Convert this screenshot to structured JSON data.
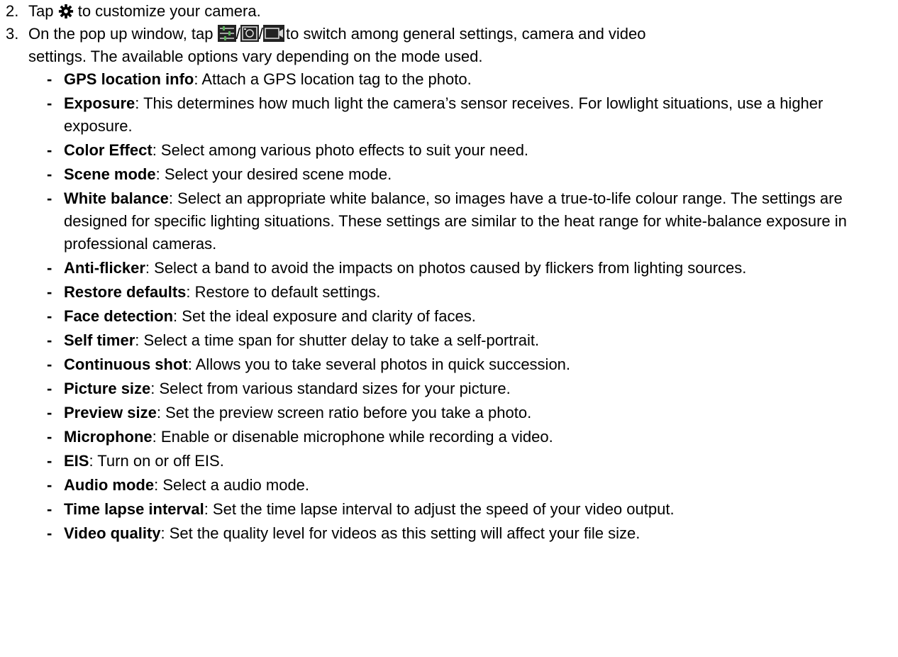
{
  "steps": {
    "step2": {
      "number": "2.",
      "text_before": "Tap ",
      "text_after": " to customize your camera.",
      "icon": "gear-icon"
    },
    "step3": {
      "number": "3.",
      "text_before": "On the pop up window, tap ",
      "separator": "/",
      "text_after": " to switch among general settings, camera and video",
      "continuation": "settings. The available options vary depending on the mode used.",
      "icons": [
        "sliders-icon",
        "camera-icon",
        "video-icon"
      ]
    }
  },
  "bullets": [
    {
      "term": "GPS location info",
      "desc": ": Attach a GPS location tag to the photo."
    },
    {
      "term": "Exposure",
      "desc": ": This determines how much light the camera’s sensor receives. For lowlight situations, use a higher exposure."
    },
    {
      "term": "Color Effect",
      "desc": ": Select among various photo effects to suit your need."
    },
    {
      "term": "Scene mode",
      "desc": ": Select your desired scene mode."
    },
    {
      "term": "White balance",
      "desc": ": Select an appropriate white balance, so images have a true-to-life colour range. The settings are designed for specific lighting situations. These settings are similar to the heat range for white-balance exposure in professional cameras."
    },
    {
      "term": "Anti-flicker",
      "desc": ": Select a band to avoid the impacts on photos caused by flickers from lighting sources."
    },
    {
      "term": "Restore defaults",
      "desc": ": Restore to default settings."
    },
    {
      "term": "Face detection",
      "desc": ":  Set the ideal exposure and clarity of faces."
    },
    {
      "term": "Self timer",
      "desc": ": Select a time span for shutter delay to take a self-portrait."
    },
    {
      "term": "Continuous shot",
      "desc": ": Allows you to take several photos in quick succession."
    },
    {
      "term": "Picture size",
      "desc": ": Select from various standard sizes for your picture."
    },
    {
      "term": "Preview size",
      "desc": ": Set the preview screen ratio before you take a photo."
    },
    {
      "term": "Microphone",
      "desc": ": Enable or disenable microphone while recording a video."
    },
    {
      "term": "EIS",
      "desc": ": Turn on or off EIS."
    },
    {
      "term": "Audio mode",
      "desc": ": Select a audio mode."
    },
    {
      "term": "Time lapse interval",
      "desc": ": Set the time lapse interval to adjust the speed of your video output."
    },
    {
      "term": "Video quality",
      "desc": ": Set the quality level for videos as this setting will affect your file size."
    }
  ],
  "bullet_marker": "-"
}
